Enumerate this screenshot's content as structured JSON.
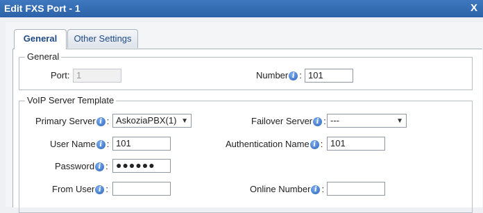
{
  "window": {
    "title": "Edit FXS Port - 1",
    "close": "X"
  },
  "tabs": [
    {
      "label": "General"
    },
    {
      "label": "Other Settings"
    }
  ],
  "general": {
    "legend": "General",
    "port": {
      "label": "Port:",
      "value": "1"
    },
    "number": {
      "label": "Number",
      "value": "101"
    }
  },
  "voip": {
    "legend": "VoIP Server Template",
    "primary_server": {
      "label": "Primary Server",
      "value": "AskoziaPBX(1)"
    },
    "failover_server": {
      "label": "Failover Server",
      "value": "---"
    },
    "user_name": {
      "label": "User Name",
      "value": "101"
    },
    "auth_name": {
      "label": "Authentication Name",
      "value": "101"
    },
    "password": {
      "label": "Password",
      "value": "●●●●●●"
    },
    "from_user": {
      "label": "From User",
      "value": ""
    },
    "online_number": {
      "label": "Online Number",
      "value": ""
    }
  },
  "ui": {
    "info_glyph": "i",
    "colon": ":",
    "dropdown_arrow": "▼"
  }
}
